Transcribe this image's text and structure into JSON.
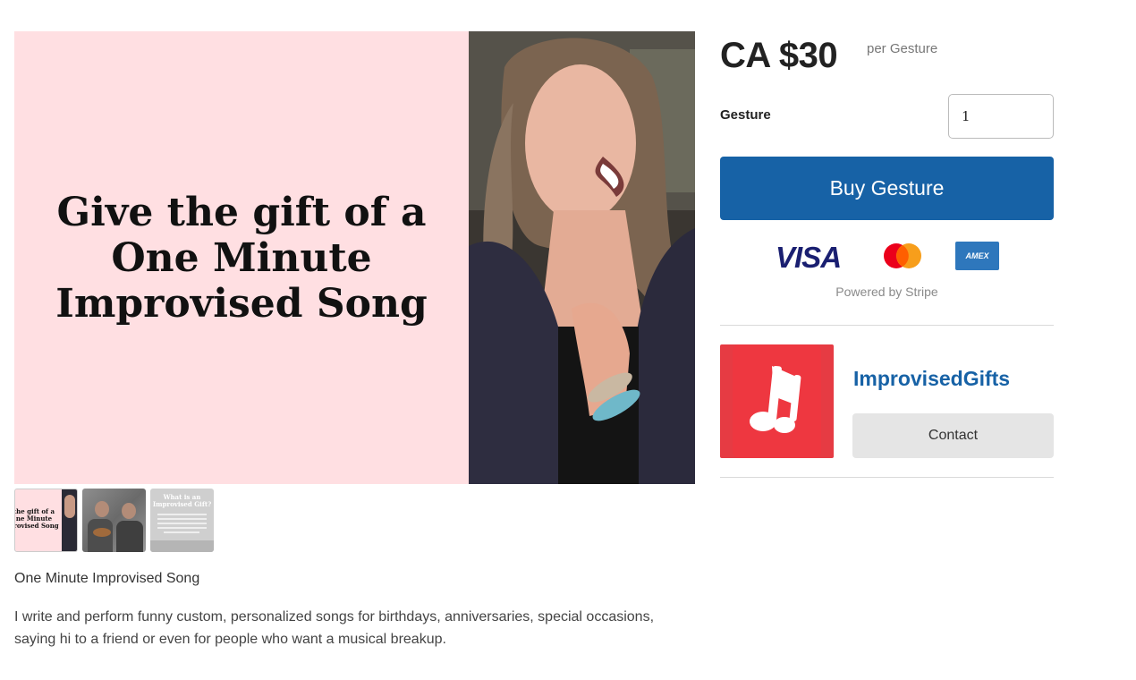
{
  "hero": {
    "headline_line1": "Give the gift of a",
    "headline_line2": "One Minute",
    "headline_line3": "Improvised Song",
    "background_color": "#ffdfe2"
  },
  "thumbnails": [
    {
      "label_line1": "the gift of a",
      "label_line2": "ne Minute",
      "label_line3": "provised Song"
    },
    {
      "label": ""
    },
    {
      "title_line1": "What is an",
      "title_line2": "Improvised Gift?"
    }
  ],
  "product": {
    "name": "One Minute Improvised Song",
    "description": "I write and perform funny custom, personalized songs for birthdays, anniversaries, special occasions, saying hi to a friend or even for people who want a musical breakup."
  },
  "pricing": {
    "price": "CA $30",
    "per": "per Gesture"
  },
  "purchase": {
    "quantity_label": "Gesture",
    "quantity_value": "1",
    "buy_label": "Buy Gesture",
    "buy_color": "#1762a6"
  },
  "payment": {
    "visa": "VISA",
    "amex": "AMEX",
    "powered_by": "Powered by Stripe"
  },
  "seller": {
    "name": "ImprovisedGifts",
    "contact_label": "Contact",
    "logo_icon": "music-note-icon",
    "logo_color": "#e63b43"
  }
}
